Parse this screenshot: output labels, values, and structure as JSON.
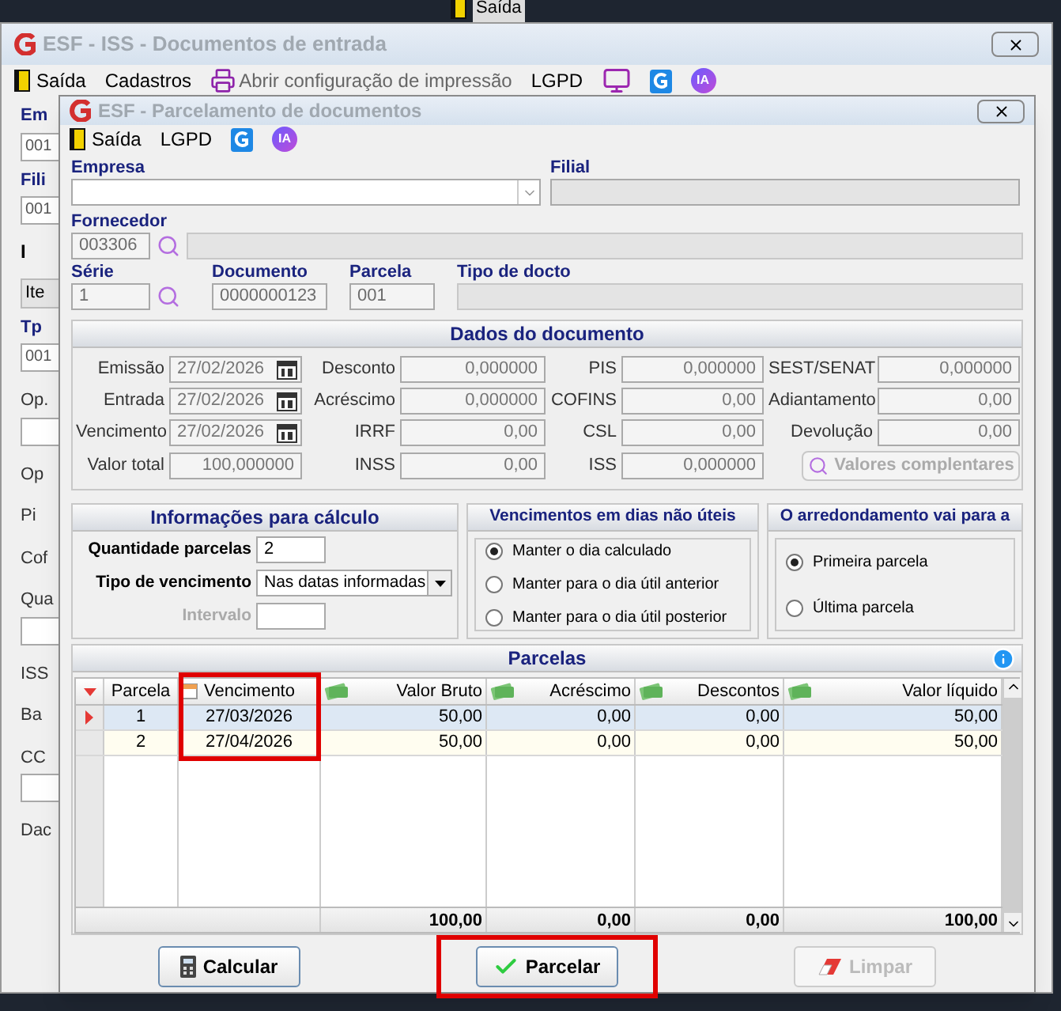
{
  "top_strip": {
    "exit": "Saída"
  },
  "background_window": {
    "title": "ESF - ISS - Documentos de entrada",
    "toolbar": [
      {
        "kind": "exit",
        "label": "Saída"
      },
      {
        "kind": "text",
        "label": "Cadastros"
      },
      {
        "kind": "print",
        "label": "Abrir configuração de impressão"
      },
      {
        "kind": "text",
        "label": "LGPD"
      },
      {
        "kind": "monitor"
      },
      {
        "kind": "logo"
      },
      {
        "kind": "ai",
        "label": "IA"
      }
    ],
    "left_fragments": [
      {
        "kind": "label",
        "text": "Em"
      },
      {
        "kind": "field",
        "text": "001"
      },
      {
        "kind": "label",
        "text": "Fili"
      },
      {
        "kind": "field",
        "text": "001"
      },
      {
        "kind": "edit",
        "text": "I"
      },
      {
        "kind": "tab",
        "text": "Ite"
      },
      {
        "kind": "label",
        "text": "Tp"
      },
      {
        "kind": "field",
        "text": "001"
      },
      {
        "kind": "plain",
        "text": "Op."
      },
      {
        "kind": "field"
      },
      {
        "kind": "plain",
        "text": "Op"
      },
      {
        "kind": "plain",
        "text": "Pi"
      },
      {
        "kind": "plain",
        "text": "Cof"
      },
      {
        "kind": "plain",
        "text": "Qua"
      },
      {
        "kind": "field"
      },
      {
        "kind": "plain",
        "text": "ISS"
      },
      {
        "kind": "plain",
        "text": "Ba"
      },
      {
        "kind": "plain",
        "text": "CC"
      },
      {
        "kind": "field"
      },
      {
        "kind": "plain",
        "text": "Dac"
      }
    ]
  },
  "dialog": {
    "title": "ESF - Parcelamento de documentos",
    "toolbar": [
      {
        "kind": "exit",
        "label": "Saída"
      },
      {
        "kind": "text",
        "label": "LGPD"
      },
      {
        "kind": "logo"
      },
      {
        "kind": "ai",
        "label": "IA"
      }
    ],
    "empresa": {
      "label": "Empresa"
    },
    "filial": {
      "label": "Filial"
    },
    "fornecedor": {
      "label": "Fornecedor",
      "value": "003306"
    },
    "serie": {
      "label": "Série",
      "value": "1"
    },
    "documento": {
      "label": "Documento",
      "value": "0000000123"
    },
    "parcela": {
      "label": "Parcela",
      "value": "001"
    },
    "tipo_docto": {
      "label": "Tipo de docto"
    },
    "dados": {
      "title": "Dados do documento",
      "fields": [
        {
          "kind": "date",
          "label": "Emissão",
          "value": "27/02/2026"
        },
        {
          "kind": "number",
          "label": "Desconto",
          "value": "0,000000"
        },
        {
          "kind": "number",
          "label": "PIS",
          "value": "0,000000"
        },
        {
          "kind": "number",
          "label": "SEST/SENAT",
          "value": "0,000000"
        },
        {
          "kind": "date",
          "label": "Entrada",
          "value": "27/02/2026"
        },
        {
          "kind": "number",
          "label": "Acréscimo",
          "value": "0,000000"
        },
        {
          "kind": "number",
          "label": "COFINS",
          "value": "0,00"
        },
        {
          "kind": "number",
          "label": "Adiantamento",
          "value": "0,00"
        },
        {
          "kind": "date",
          "label": "Vencimento",
          "value": "27/02/2026"
        },
        {
          "kind": "number",
          "label": "IRRF",
          "value": "0,00"
        },
        {
          "kind": "number",
          "label": "CSL",
          "value": "0,00"
        },
        {
          "kind": "number",
          "label": "Devolução",
          "value": "0,00"
        },
        {
          "kind": "number",
          "label": "Valor total",
          "value": "100,000000"
        },
        {
          "kind": "number",
          "label": "INSS",
          "value": "0,00"
        },
        {
          "kind": "number",
          "label": "ISS",
          "value": "0,000000"
        },
        {
          "kind": "button",
          "label": "Valores complentares",
          "disabled": true
        }
      ]
    },
    "calculo": {
      "title": "Informações para cálculo",
      "quantidade": {
        "label": "Quantidade parcelas",
        "value": "2"
      },
      "tipo": {
        "label": "Tipo de vencimento",
        "value": "Nas datas informadas"
      },
      "intervalo": {
        "label": "Intervalo",
        "disabled": true
      }
    },
    "vencimentos": {
      "title": "Vencimentos em dias não úteis",
      "options": [
        {
          "label": "Manter o dia calculado",
          "selected": true
        },
        {
          "label": "Manter para o dia útil anterior",
          "selected": false
        },
        {
          "label": "Manter para o dia útil posterior",
          "selected": false
        }
      ]
    },
    "arredondamento": {
      "title": "O arredondamento vai para a",
      "options": [
        {
          "label": "Primeira parcela",
          "selected": true
        },
        {
          "label": "Última parcela",
          "selected": false
        }
      ]
    },
    "parcelas": {
      "title": "Parcelas",
      "columns": [
        {
          "label": "Parcela",
          "kind": "plain",
          "highlighted": false
        },
        {
          "label": "Vencimento",
          "kind": "date",
          "highlighted": true
        },
        {
          "label": "Valor Bruto",
          "kind": "money",
          "highlighted": false
        },
        {
          "label": "Acréscimo",
          "kind": "money",
          "highlighted": false
        },
        {
          "label": "Descontos",
          "kind": "money",
          "highlighted": false
        },
        {
          "label": "Valor líquido",
          "kind": "money",
          "highlighted": false
        }
      ],
      "rows": [
        {
          "selected": true,
          "cells": [
            "1",
            "27/03/2026",
            "50,00",
            "0,00",
            "0,00",
            "50,00"
          ]
        },
        {
          "selected": false,
          "cells": [
            "2",
            "27/04/2026",
            "50,00",
            "0,00",
            "0,00",
            "50,00"
          ]
        }
      ],
      "totals": [
        "100,00",
        "0,00",
        "0,00",
        "100,00"
      ]
    },
    "buttons": [
      {
        "kind": "calculator",
        "label": "Calcular",
        "disabled": false,
        "highlighted": false
      },
      {
        "kind": "check",
        "label": "Parcelar",
        "disabled": false,
        "highlighted": true
      },
      {
        "kind": "eraser",
        "label": "Limpar",
        "disabled": true,
        "highlighted": false
      }
    ]
  }
}
